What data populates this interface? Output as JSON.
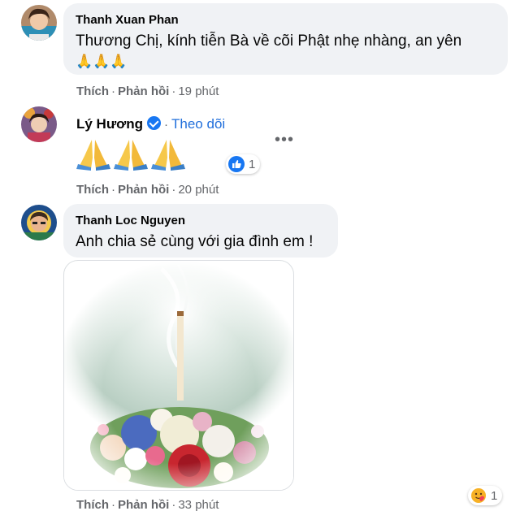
{
  "comments": [
    {
      "author": "Thanh Xuan Phan",
      "text": "Thương Chị, kính tiễn Bà về cõi Phật nhẹ nhàng, an yên",
      "emoji": "🙏🙏🙏",
      "like_label": "Thích",
      "reply_label": "Phản hồi",
      "time": "19 phút",
      "separator": "·"
    },
    {
      "author": "Lý Hương",
      "follow_label": "Theo dõi",
      "follow_separator": "·",
      "reaction_count": "1",
      "more_label": "•••",
      "like_label": "Thích",
      "reply_label": "Phản hồi",
      "time": "20 phút",
      "separator": "·"
    },
    {
      "author": "Thanh Loc Nguyen",
      "text": "Anh chia sẻ cùng với gia đình em !",
      "like_label": "Thích",
      "reply_label": "Phản hồi",
      "time": "33 phút",
      "separator": "·",
      "reaction_count": "1"
    }
  ],
  "colors": {
    "bubble": "#f0f2f5",
    "link_blue": "#216fdb",
    "muted": "#65676b",
    "like_blue": "#1877f2"
  },
  "icons": [
    "verified-badge-icon",
    "folded-hands-icon",
    "like-reaction-icon",
    "care-reaction-icon",
    "more-options-icon"
  ]
}
